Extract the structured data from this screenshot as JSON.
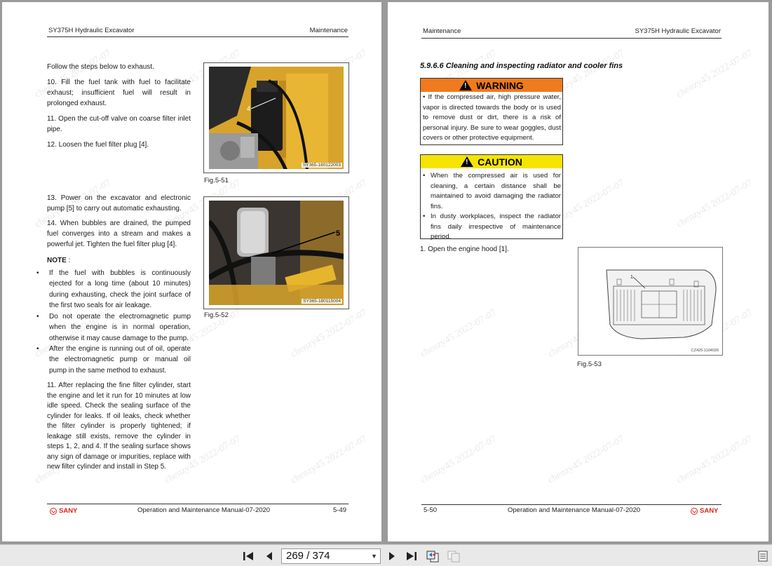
{
  "watermark": "chenzy45 2022-07-07",
  "left_page": {
    "header_left": "SY375H Hydraulic Excavator",
    "header_right": "Maintenance",
    "para1": "Follow the steps below to exhaust.",
    "para2": "10. Fill the fuel tank with fuel to facilitate exhaust; insufficient fuel will result in prolonged exhaust.",
    "para3": "11. Open the cut-off valve on coarse filter inlet pipe.",
    "para4": "12. Loosen the fuel filter plug [4].",
    "para5": "13. Power on the excavator and electronic pump [5] to carry out automatic exhausting.",
    "para6": "14. When bubbles are drained, the pumped fuel converges into a stream and makes a powerful jet. Tighten the fuel filter plug [4].",
    "note_label": "NOTE",
    "note_suffix": ":",
    "notes": [
      "If the fuel with bubbles is continuously ejected for a long time (about 10 minutes) during exhausting, check the joint surface of the first two seals for air leakage.",
      "Do not operate the electromagnetic pump when the engine is in normal operation, otherwise it may cause damage to the pump.",
      "After the engine is running out of oil, operate the electromagnetic pump or manual oil pump in the same method to exhaust."
    ],
    "para7": "11. After replacing the fine filter cylinder, start the engine and let it run for 10 minutes at low idle speed. Check the sealing surface of the cylinder for leaks. If oil leaks, check whether the filter cylinder is properly tightened; if leakage still exists, remove the cylinder in steps 1, 2, and 4. If the sealing surface shows any sign of damage or impurities, replace with new filter cylinder and install in Step 5.",
    "fig1_code": "SY365-180122003",
    "fig1_callout": "4",
    "fig1_caption": "Fig.5-51",
    "fig2_code": "SY365-180115004",
    "fig2_callout": "5",
    "fig2_caption": "Fig.5-52",
    "footer_brand": "SANY",
    "footer_center": "Operation and Maintenance Manual-07-2020",
    "footer_page": "5-49"
  },
  "right_page": {
    "header_left": "Maintenance",
    "header_right": "SY375H Hydraulic Excavator",
    "section_title": "5.9.6.6 Cleaning and inspecting radiator and cooler fins",
    "warning_label": "WARNING",
    "warning_text": "• If the compressed air, high pressure water, vapor is directed towards the body or is used to remove dust or dirt, there is a risk of personal injury. Be sure to wear goggles, dust covers or other protective equipment.",
    "caution_label": "CAUTION",
    "caution_items": [
      "When the compressed air is used for cleaning, a certain distance shall be maintained to avoid damaging the radiator fins.",
      "In dusty workplaces, inspect the radiator fins daily irrespective of maintenance period."
    ],
    "step1": "1. Open the engine hood [1].",
    "fig_code": "CZ425-1104026",
    "fig_callout": "1",
    "fig_caption": "Fig.5-53",
    "footer_page": "5-50",
    "footer_center": "Operation and Maintenance Manual-07-2020",
    "footer_brand": "SANY"
  },
  "toolbar": {
    "page_indicator": "269 / 374",
    "icons": [
      "first-page-icon",
      "previous-page-icon",
      "next-page-icon",
      "last-page-icon",
      "go-back-view-icon",
      "go-forward-view-icon",
      "sidebar-toggle-icon"
    ]
  }
}
